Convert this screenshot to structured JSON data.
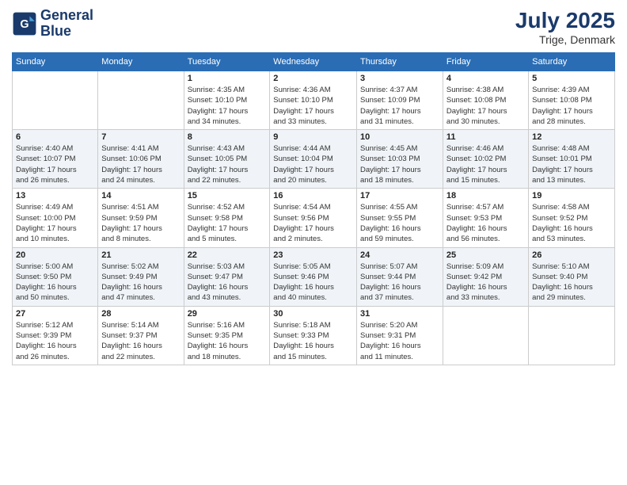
{
  "logo": {
    "line1": "General",
    "line2": "Blue"
  },
  "title": {
    "month": "July 2025",
    "location": "Trige, Denmark"
  },
  "weekdays": [
    "Sunday",
    "Monday",
    "Tuesday",
    "Wednesday",
    "Thursday",
    "Friday",
    "Saturday"
  ],
  "weeks": [
    [
      {
        "day": "",
        "info": ""
      },
      {
        "day": "",
        "info": ""
      },
      {
        "day": "1",
        "info": "Sunrise: 4:35 AM\nSunset: 10:10 PM\nDaylight: 17 hours\nand 34 minutes."
      },
      {
        "day": "2",
        "info": "Sunrise: 4:36 AM\nSunset: 10:10 PM\nDaylight: 17 hours\nand 33 minutes."
      },
      {
        "day": "3",
        "info": "Sunrise: 4:37 AM\nSunset: 10:09 PM\nDaylight: 17 hours\nand 31 minutes."
      },
      {
        "day": "4",
        "info": "Sunrise: 4:38 AM\nSunset: 10:08 PM\nDaylight: 17 hours\nand 30 minutes."
      },
      {
        "day": "5",
        "info": "Sunrise: 4:39 AM\nSunset: 10:08 PM\nDaylight: 17 hours\nand 28 minutes."
      }
    ],
    [
      {
        "day": "6",
        "info": "Sunrise: 4:40 AM\nSunset: 10:07 PM\nDaylight: 17 hours\nand 26 minutes."
      },
      {
        "day": "7",
        "info": "Sunrise: 4:41 AM\nSunset: 10:06 PM\nDaylight: 17 hours\nand 24 minutes."
      },
      {
        "day": "8",
        "info": "Sunrise: 4:43 AM\nSunset: 10:05 PM\nDaylight: 17 hours\nand 22 minutes."
      },
      {
        "day": "9",
        "info": "Sunrise: 4:44 AM\nSunset: 10:04 PM\nDaylight: 17 hours\nand 20 minutes."
      },
      {
        "day": "10",
        "info": "Sunrise: 4:45 AM\nSunset: 10:03 PM\nDaylight: 17 hours\nand 18 minutes."
      },
      {
        "day": "11",
        "info": "Sunrise: 4:46 AM\nSunset: 10:02 PM\nDaylight: 17 hours\nand 15 minutes."
      },
      {
        "day": "12",
        "info": "Sunrise: 4:48 AM\nSunset: 10:01 PM\nDaylight: 17 hours\nand 13 minutes."
      }
    ],
    [
      {
        "day": "13",
        "info": "Sunrise: 4:49 AM\nSunset: 10:00 PM\nDaylight: 17 hours\nand 10 minutes."
      },
      {
        "day": "14",
        "info": "Sunrise: 4:51 AM\nSunset: 9:59 PM\nDaylight: 17 hours\nand 8 minutes."
      },
      {
        "day": "15",
        "info": "Sunrise: 4:52 AM\nSunset: 9:58 PM\nDaylight: 17 hours\nand 5 minutes."
      },
      {
        "day": "16",
        "info": "Sunrise: 4:54 AM\nSunset: 9:56 PM\nDaylight: 17 hours\nand 2 minutes."
      },
      {
        "day": "17",
        "info": "Sunrise: 4:55 AM\nSunset: 9:55 PM\nDaylight: 16 hours\nand 59 minutes."
      },
      {
        "day": "18",
        "info": "Sunrise: 4:57 AM\nSunset: 9:53 PM\nDaylight: 16 hours\nand 56 minutes."
      },
      {
        "day": "19",
        "info": "Sunrise: 4:58 AM\nSunset: 9:52 PM\nDaylight: 16 hours\nand 53 minutes."
      }
    ],
    [
      {
        "day": "20",
        "info": "Sunrise: 5:00 AM\nSunset: 9:50 PM\nDaylight: 16 hours\nand 50 minutes."
      },
      {
        "day": "21",
        "info": "Sunrise: 5:02 AM\nSunset: 9:49 PM\nDaylight: 16 hours\nand 47 minutes."
      },
      {
        "day": "22",
        "info": "Sunrise: 5:03 AM\nSunset: 9:47 PM\nDaylight: 16 hours\nand 43 minutes."
      },
      {
        "day": "23",
        "info": "Sunrise: 5:05 AM\nSunset: 9:46 PM\nDaylight: 16 hours\nand 40 minutes."
      },
      {
        "day": "24",
        "info": "Sunrise: 5:07 AM\nSunset: 9:44 PM\nDaylight: 16 hours\nand 37 minutes."
      },
      {
        "day": "25",
        "info": "Sunrise: 5:09 AM\nSunset: 9:42 PM\nDaylight: 16 hours\nand 33 minutes."
      },
      {
        "day": "26",
        "info": "Sunrise: 5:10 AM\nSunset: 9:40 PM\nDaylight: 16 hours\nand 29 minutes."
      }
    ],
    [
      {
        "day": "27",
        "info": "Sunrise: 5:12 AM\nSunset: 9:39 PM\nDaylight: 16 hours\nand 26 minutes."
      },
      {
        "day": "28",
        "info": "Sunrise: 5:14 AM\nSunset: 9:37 PM\nDaylight: 16 hours\nand 22 minutes."
      },
      {
        "day": "29",
        "info": "Sunrise: 5:16 AM\nSunset: 9:35 PM\nDaylight: 16 hours\nand 18 minutes."
      },
      {
        "day": "30",
        "info": "Sunrise: 5:18 AM\nSunset: 9:33 PM\nDaylight: 16 hours\nand 15 minutes."
      },
      {
        "day": "31",
        "info": "Sunrise: 5:20 AM\nSunset: 9:31 PM\nDaylight: 16 hours\nand 11 minutes."
      },
      {
        "day": "",
        "info": ""
      },
      {
        "day": "",
        "info": ""
      }
    ]
  ]
}
